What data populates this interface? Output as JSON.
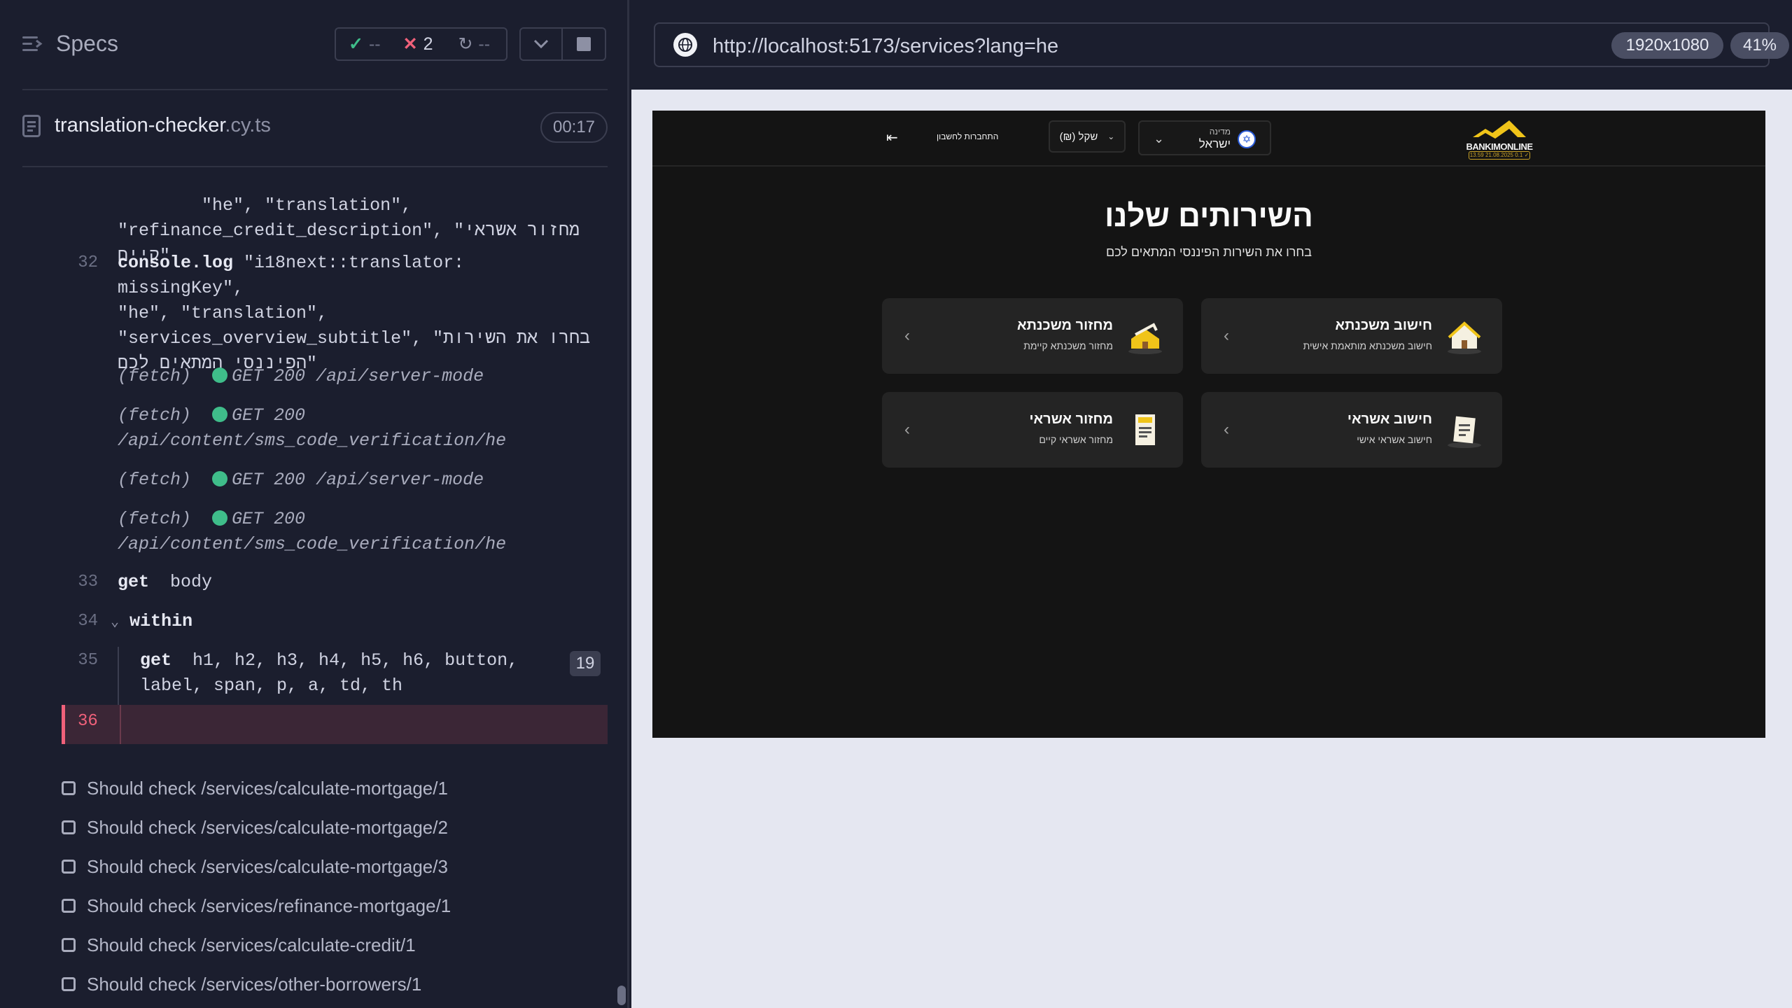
{
  "reporter": {
    "specs_label": "Specs",
    "stats": {
      "passed": "--",
      "failed": "2",
      "pending": "--"
    },
    "file": {
      "name": "translation-checker",
      "ext": ".cy.ts",
      "duration": "00:17"
    },
    "commands": [
      {
        "num": "",
        "text": "\"he\", \"translation\",\n\"refinance_credit_description\", \"מחזור אשראי\nקיים\""
      },
      {
        "num": "32",
        "kw": "console.log",
        "text": " \"i18next::translator: missingKey\",\n\"he\", \"translation\",\n\"services_overview_subtitle\", \"בחרו את השירות\nהפיננסי המתאים לכם\""
      },
      {
        "fetch": "(fetch)",
        "method": "GET 200",
        "path": "/api/server-mode"
      },
      {
        "fetch": "(fetch)",
        "method": "GET 200",
        "path": "/api/content/sms_code_verification/he"
      },
      {
        "fetch": "(fetch)",
        "method": "GET 200",
        "path": "/api/server-mode"
      },
      {
        "fetch": "(fetch)",
        "method": "GET 200",
        "path": "/api/content/sms_code_verification/he"
      },
      {
        "num": "33",
        "kw": "get",
        "text": "body"
      },
      {
        "num": "34",
        "kw": "within",
        "text": ""
      },
      {
        "num": "35",
        "kw": "get",
        "text": "h1, h2, h3, h4, h5, h6, button,\nlabel, span, p, a, td, th",
        "badge": "19"
      },
      {
        "num": "36"
      }
    ],
    "tests": [
      "Should check /services/calculate-mortgage/1",
      "Should check /services/calculate-mortgage/2",
      "Should check /services/calculate-mortgage/3",
      "Should check /services/refinance-mortgage/1",
      "Should check /services/calculate-credit/1",
      "Should check /services/other-borrowers/1"
    ]
  },
  "browser": {
    "url": "http://localhost:5173/services?lang=he",
    "viewport": "1920x1080",
    "zoom": "41%"
  },
  "app": {
    "logo_text": "BANKIMONLINE",
    "logo_sub": "13.59 21.08.2025 0.1 ✓",
    "country_label": "מדינה",
    "country_name": "ישראל",
    "currency": "(₪) שקל",
    "login": "התחברות לחשבון",
    "title": "השירותים שלנו",
    "subtitle": "בחרו את השירות הפיננסי המתאים לכם",
    "cards": [
      {
        "title": "חישוב משכנתא",
        "desc": "חישוב משכנתא מותאמת אישית"
      },
      {
        "title": "מחזור משכנתא",
        "desc": "מחזור משכנתא קיימת"
      },
      {
        "title": "חישוב אשראי",
        "desc": "חישוב אשראי אישי"
      },
      {
        "title": "מחזור אשראי",
        "desc": "מחזור אשראי קיים"
      }
    ]
  }
}
